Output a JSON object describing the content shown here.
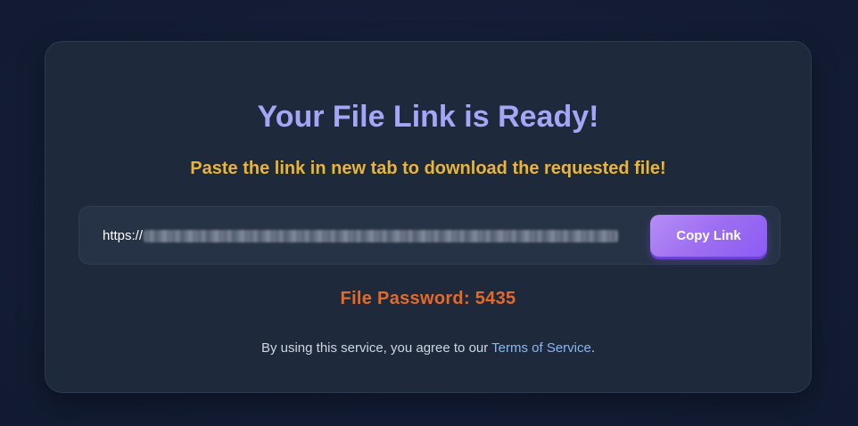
{
  "card": {
    "title": "Your File Link is Ready!",
    "subtitle": "Paste the link in new tab to download the requested file!"
  },
  "link": {
    "prefix": "https://",
    "copy_label": "Copy Link"
  },
  "password": {
    "text": "File Password: 5435"
  },
  "footer": {
    "text_before": "By using this service, you agree to our ",
    "tos_label": "Terms of Service",
    "text_after": "."
  },
  "colors": {
    "title": "#a5a6f6",
    "subtitle": "#e8b43a",
    "password": "#e56a2a",
    "button": "#8b5cf6",
    "link": "#8ab7f0"
  }
}
